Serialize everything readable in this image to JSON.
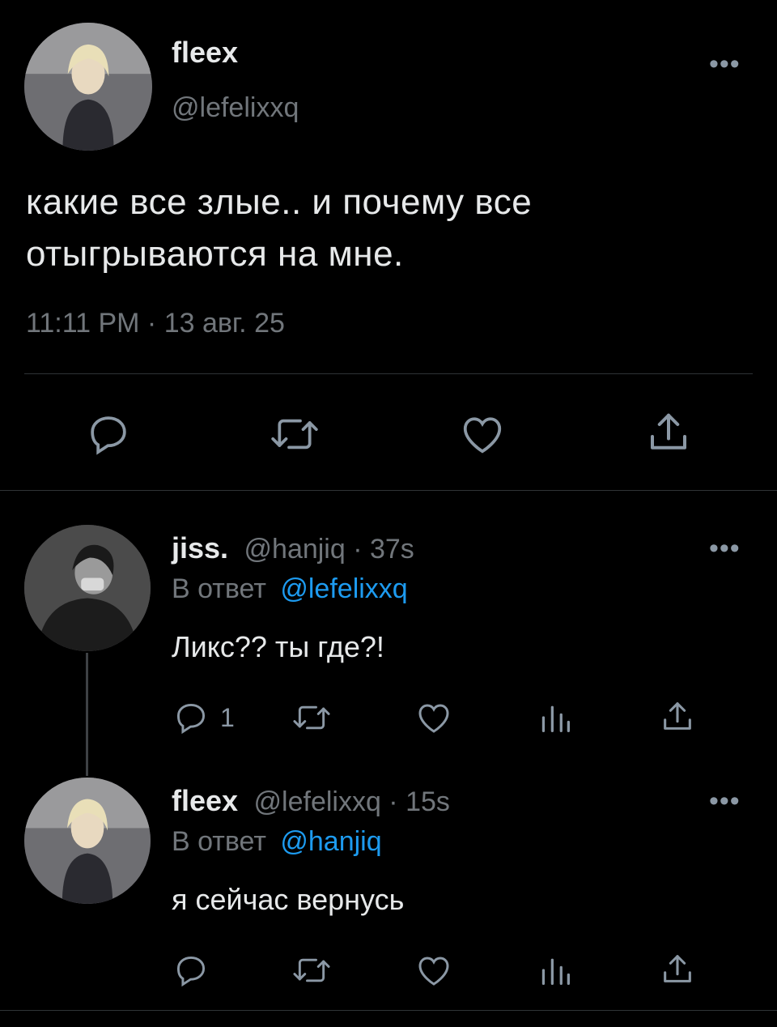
{
  "main_tweet": {
    "display_name": "fleex",
    "handle": "@lefelixxq",
    "text_line1": "какие все злые.. и почему все",
    "text_line2": "отыгрываются на мне.",
    "timestamp": "11:11 PM · 13 авг. 25",
    "more": "•••"
  },
  "replies": [
    {
      "display_name": "jiss.",
      "handle_time": "@hanjiq · 37s",
      "reply_prefix": "В ответ",
      "reply_to": "@lefelixxq",
      "text": "Ликс?? ты где?!",
      "reply_count": "1",
      "more": "•••"
    },
    {
      "display_name": "fleex",
      "handle_time": "@lefelixxq · 15s",
      "reply_prefix": "В ответ",
      "reply_to": "@hanjiq",
      "text": "я сейчас вернусь",
      "more": "•••"
    }
  ],
  "icons": {
    "reply": "reply-icon",
    "retweet": "retweet-icon",
    "like": "like-icon",
    "share": "share-icon",
    "views": "views-icon"
  }
}
